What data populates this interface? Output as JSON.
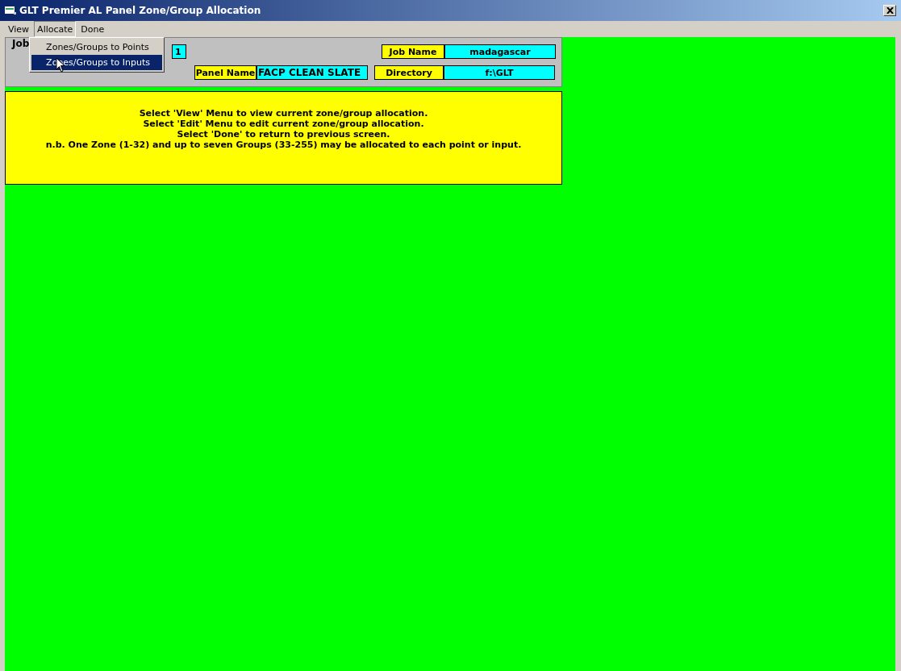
{
  "window": {
    "title": "GLT Premier AL Panel Zone/Group Allocation"
  },
  "menu": [
    {
      "label": "View",
      "expanded": false
    },
    {
      "label": "Allocate",
      "expanded": true
    },
    {
      "label": "Done",
      "expanded": false
    }
  ],
  "dropdown": [
    {
      "label": "Zones/Groups to Points",
      "selected": false
    },
    {
      "label": "Zones/Groups to Inputs",
      "selected": true
    }
  ],
  "job_group": {
    "title": "Job",
    "number": "1",
    "job_name_label": "Job Name",
    "job_name": "madagascar",
    "panel_name_label": "Panel Name",
    "panel_name": "FACP CLEAN SLATE",
    "directory_label": "Directory",
    "directory": "f:\\GLT"
  },
  "instructions": [
    "Select 'View' Menu to view current zone/group allocation.",
    "Select 'Edit' Menu to edit current zone/group allocation.",
    "Select 'Done' to return to previous screen.",
    "n.b. One Zone (1-32) and up to seven Groups (33-255) may be allocated to each point or input."
  ]
}
